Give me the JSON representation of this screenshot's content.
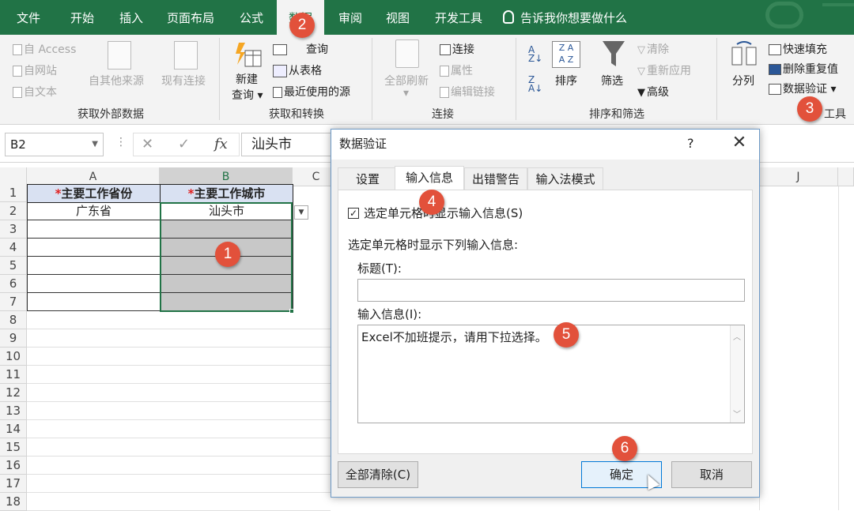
{
  "ribbon_tabs": [
    "文件",
    "开始",
    "插入",
    "页面布局",
    "公式",
    "数据",
    "审阅",
    "视图",
    "开发工具"
  ],
  "active_tab": "数据",
  "tell_me": "告诉我你想要做什么",
  "ribbon": {
    "external": {
      "access": "自 Access",
      "web": "自网站",
      "text": "自文本",
      "other": "自其他来源",
      "existing": "现有连接",
      "label": "获取外部数据"
    },
    "transform": {
      "new_query": "新建\n查询",
      "new_query_l1": "新建",
      "new_query_l2": "查询",
      "show_queries": "显示查询",
      "show_queries_visible": "查询",
      "from_table": "从表格",
      "recent": "最近使用的源",
      "label": "获取和转换"
    },
    "connections": {
      "refresh_all": "全部刷新",
      "connections": "连接",
      "properties": "属性",
      "edit_links": "编辑链接",
      "label": "连接"
    },
    "sort": {
      "sort": "排序",
      "filter": "筛选",
      "clear": "清除",
      "reapply": "重新应用",
      "advanced": "高级",
      "label": "排序和筛选"
    },
    "tools": {
      "text_to_columns": "分列",
      "flash_fill": "快速填充",
      "remove_dup": "删除重复值",
      "validation": "数据验证",
      "label_visible": "工具"
    }
  },
  "formula_bar": {
    "name_box": "B2",
    "formula": "汕头市",
    "fx": "fx"
  },
  "columns": [
    "A",
    "B",
    "C",
    "J"
  ],
  "rows": [
    "1",
    "2",
    "3",
    "4",
    "5",
    "6",
    "7",
    "8",
    "9",
    "10",
    "11",
    "12",
    "13",
    "14",
    "15",
    "16",
    "17",
    "18"
  ],
  "cells": {
    "A1": "主要工作省份",
    "B1": "主要工作城市",
    "star": "*",
    "A2": "广东省",
    "B2": "汕头市"
  },
  "dialog": {
    "title": "数据验证",
    "help": "?",
    "tabs": [
      "设置",
      "输入信息",
      "出错警告",
      "输入法模式"
    ],
    "active_tab": "输入信息",
    "checkbox_label": "选定单元格时显示输入信息(S)",
    "checkbox_checked": true,
    "section_label": "选定单元格时显示下列输入信息:",
    "title_label": "标题(T):",
    "title_value": "",
    "message_label": "输入信息(I):",
    "message_value": "Excel不加班提示，请用下拉选择。",
    "clear_all": "全部清除(C)",
    "ok": "确定",
    "cancel": "取消"
  },
  "badges": [
    "1",
    "2",
    "3",
    "4",
    "5",
    "6"
  ],
  "colors": {
    "excel_green": "#217346",
    "header_fill": "#d9e1f2",
    "badge": "#e2513b",
    "selected_fill": "#c8c8c8"
  }
}
